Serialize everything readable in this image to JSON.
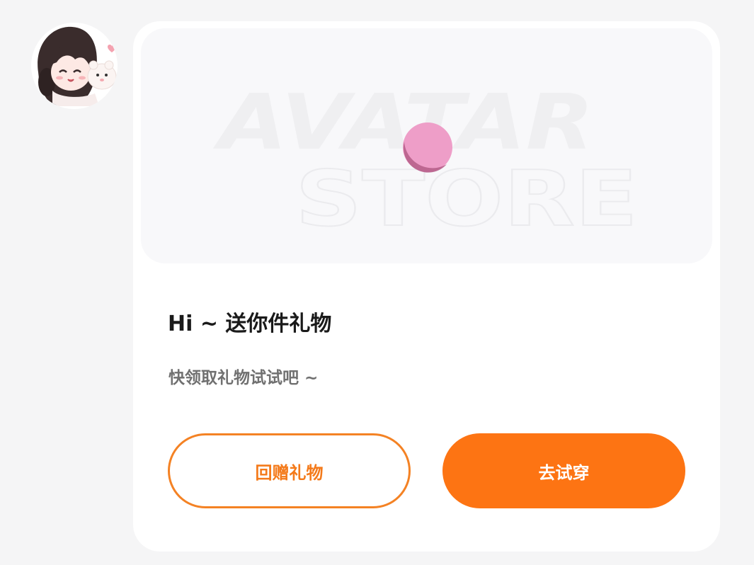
{
  "avatar": {
    "icon": "anime-girl-with-bear-avatar"
  },
  "banner": {
    "line1": "AVATAR",
    "line2": "STORE",
    "icon": "pink-ball-icon"
  },
  "gift": {
    "title": "Hi ~ 送你件礼物",
    "subtitle": "快领取礼物试试吧 ~"
  },
  "actions": {
    "return_gift_label": "回赠礼物",
    "try_on_label": "去试穿"
  },
  "colors": {
    "accent": "#fd7413",
    "outline": "#f48224",
    "page_background": "#f5f5f6",
    "card_background": "#ffffff"
  }
}
